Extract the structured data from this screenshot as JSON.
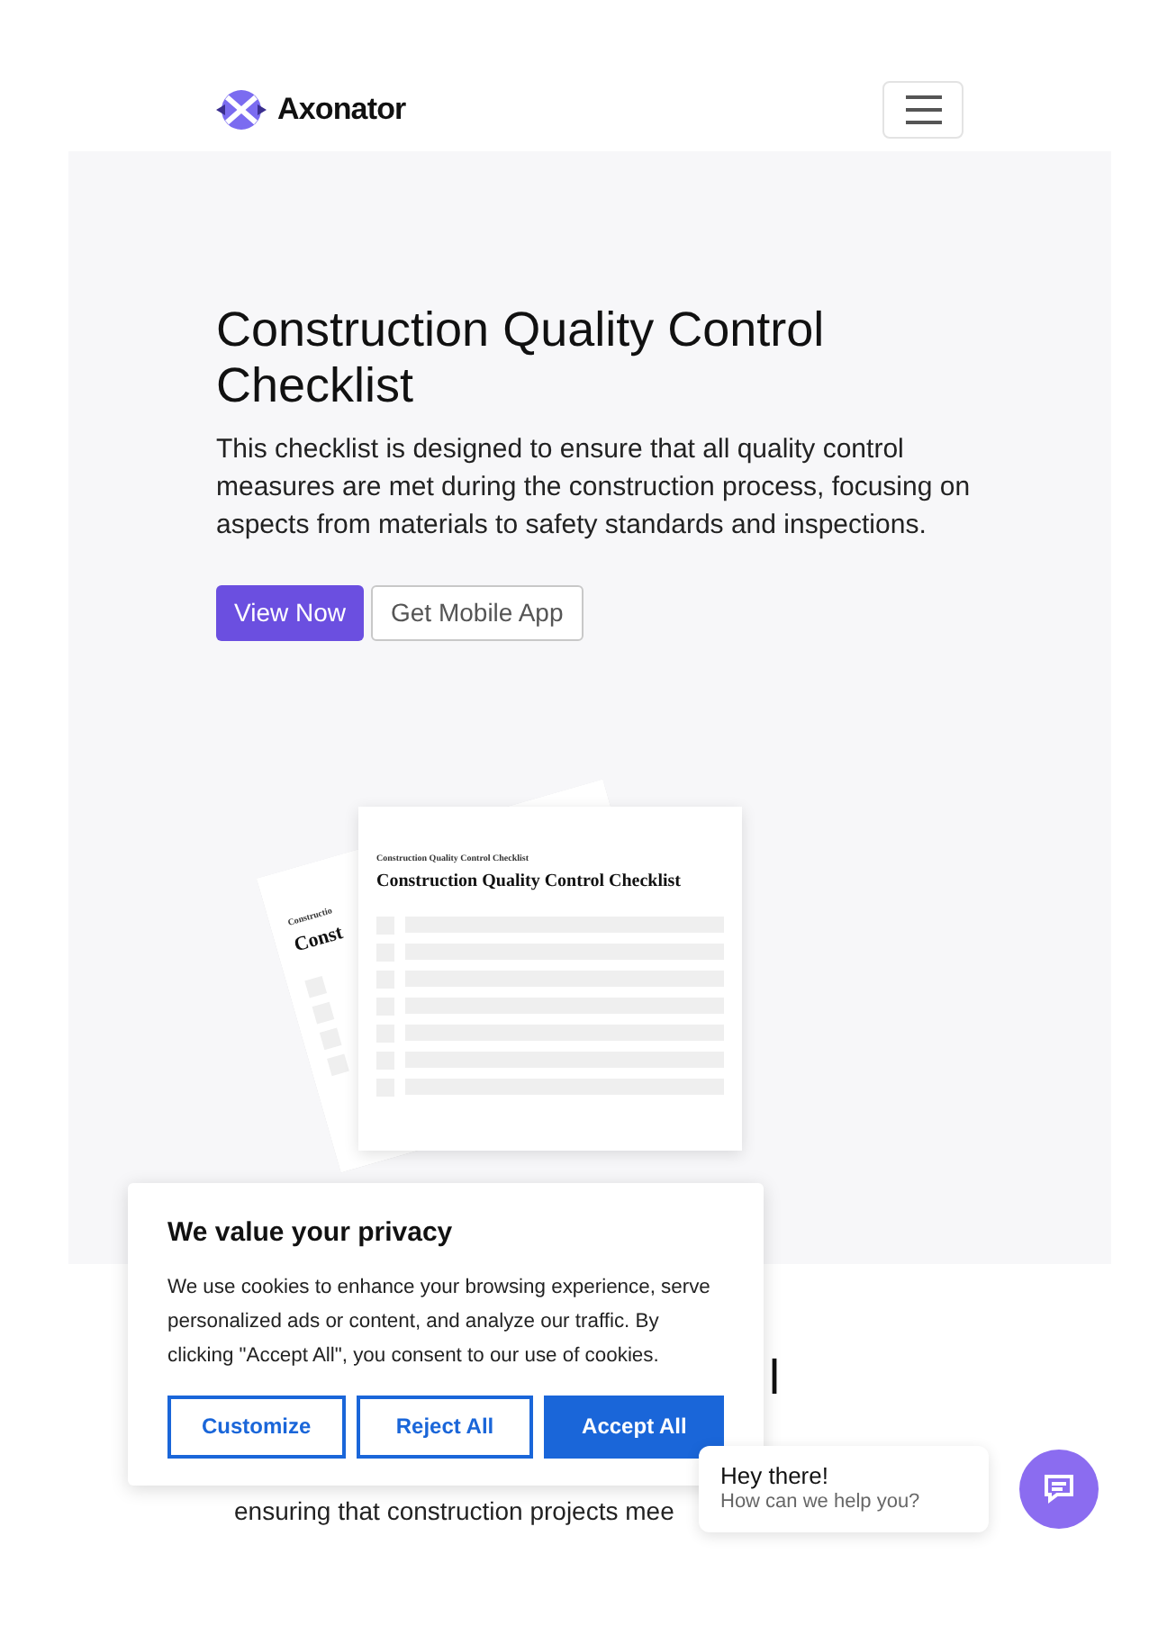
{
  "header": {
    "brand": "Axonator"
  },
  "hero": {
    "title": "Construction Quality Control Checklist",
    "description": "This checklist is designed to ensure that all quality control measures are met during the construction process, focusing on aspects from materials to safety standards and inspections.",
    "buttons": [
      {
        "label": "View Now",
        "kind": "primary"
      },
      {
        "label": "Get Mobile App",
        "kind": "secondary"
      }
    ],
    "preview": {
      "back_page": {
        "kicker": "Constructio",
        "title": "Const"
      },
      "front_page": {
        "kicker": "Construction Quality Control Checklist",
        "title": "Construction Quality Control Checklist"
      }
    }
  },
  "section": {
    "heading_fragment": "l",
    "body_fragment": "ensuring that construction projects mee"
  },
  "cookie_banner": {
    "title": "We value your privacy",
    "text": "We use cookies to enhance your browsing experience, serve personalized ads or content, and analyze our traffic. By clicking \"Accept All\", you consent to our use of cookies.",
    "buttons": [
      {
        "label": "Customize",
        "kind": "outline"
      },
      {
        "label": "Reject All",
        "kind": "outline"
      },
      {
        "label": "Accept All",
        "kind": "filled"
      }
    ]
  },
  "chat": {
    "greeting": "Hey there!",
    "prompt": "How can we help you?"
  }
}
